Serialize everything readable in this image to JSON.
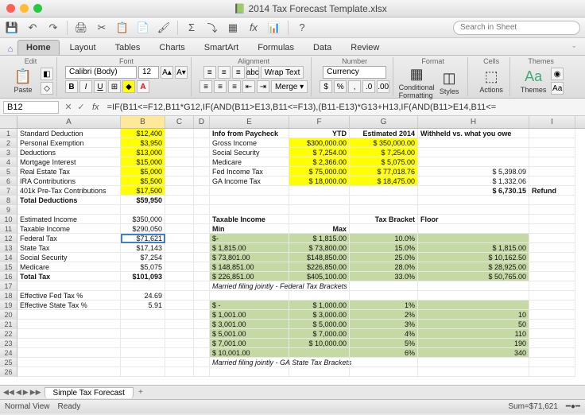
{
  "window": {
    "title": "2014 Tax Forecast Template.xlsx"
  },
  "search": {
    "placeholder": "Search in Sheet"
  },
  "tabs": [
    "Home",
    "Layout",
    "Tables",
    "Charts",
    "SmartArt",
    "Formulas",
    "Data",
    "Review"
  ],
  "ribbon": {
    "edit": "Edit",
    "font": "Font",
    "alignment": "Alignment",
    "number": "Number",
    "format": "Format",
    "cells": "Cells",
    "themes": "Themes",
    "paste": "Paste",
    "fontname": "Calibri (Body)",
    "fontsize": "12",
    "wrap": "Wrap Text",
    "numfmt": "Currency",
    "conditional": "Conditional Formatting",
    "styles": "Styles",
    "actions": "Actions",
    "themesbtn": "Themes"
  },
  "namebox": "B12",
  "formula": "=IF(B11<=F12,B11*G12,IF(AND(B11>E13,B11<=F13),(B11-E13)*G13+H13,IF(AND(B11>E14,B11<=",
  "cols": [
    "A",
    "B",
    "C",
    "D",
    "E",
    "F",
    "G",
    "H",
    "I"
  ],
  "grid": {
    "r1": {
      "A": "Standard Deduction",
      "B": "$12,400",
      "E": "Info from Paycheck",
      "F": "YTD",
      "G": "Estimated 2014",
      "H": "Withheld vs. what you owe"
    },
    "r2": {
      "A": "Personal Exemption",
      "B": "$3,950",
      "E": "Gross Income",
      "F": "$300,000.00",
      "G": "$   350,000.00"
    },
    "r3": {
      "A": "Deductions",
      "B": "$13,000",
      "E": "Social Security",
      "F": "$    7,254.00",
      "G": "$       7,254.00"
    },
    "r4": {
      "A": "Mortgage Interest",
      "B": "$15,000",
      "E": "Medicare",
      "F": "$    2,366.00",
      "G": "$       5,075.00"
    },
    "r5": {
      "A": "Real Estate Tax",
      "B": "$5,000",
      "E": "Fed Income Tax",
      "F": "$  75,000.00",
      "G": "$     77,018.76",
      "H": "$                         5,398.09"
    },
    "r6": {
      "A": "IRA Contributions",
      "B": "$5,500",
      "E": "GA Income Tax",
      "F": "$  18,000.00",
      "G": "$     18,475.00",
      "H": "$                         1,332.06"
    },
    "r7": {
      "A": "401k Pre-Tax Contributions",
      "B": "$17,500",
      "H": "$                         6,730.15",
      "I": "Refund"
    },
    "r8": {
      "A": "Total Deductions",
      "B": "$59,950"
    },
    "r10": {
      "A": "Estimated Income",
      "B": "$350,000",
      "E": "Taxable Income",
      "G": "Tax Bracket",
      "H": "Floor"
    },
    "r11": {
      "A": "Taxable Income",
      "B": "$290,050",
      "E": "Min",
      "F": "Max"
    },
    "r12": {
      "A": "Federal Tax",
      "B": "$71,621",
      "E": "$-",
      "F": "$    1,815.00",
      "G": "10.0%"
    },
    "r13": {
      "A": "State Tax",
      "B": "$17,143",
      "E": "$           1,815.00",
      "F": "$  73,800.00",
      "G": "15.0%",
      "H": "$                         1,815.00"
    },
    "r14": {
      "A": "Social Security",
      "B": "$7,254",
      "E": "$         73,801.00",
      "F": "$148,850.00",
      "G": "25.0%",
      "H": "$                       10,162.50"
    },
    "r15": {
      "A": "Medicare",
      "B": "$5,075",
      "E": "$       148,851.00",
      "F": "$226,850.00",
      "G": "28.0%",
      "H": "$                       28,925.00"
    },
    "r16": {
      "A": "Total Tax",
      "B": "$101,093",
      "E": "$       226,851.00",
      "F": "$405,100.00",
      "G": "33.0%",
      "H": "$                       50,765.00"
    },
    "r17": {
      "E": "Married filing jointly - Federal Tax Brackets"
    },
    "r18": {
      "A": "Effective Fed Tax %",
      "B": "24.69"
    },
    "r19": {
      "A": "Effective State Tax %",
      "B": "5.91",
      "E": "$                        -",
      "F": "$    1,000.00",
      "G": "1%"
    },
    "r20": {
      "E": "$           1,001.00",
      "F": "$    3,000.00",
      "G": "2%",
      "H": "10"
    },
    "r21": {
      "E": "$           3,001.00",
      "F": "$    5,000.00",
      "G": "3%",
      "H": "50"
    },
    "r22": {
      "E": "$           5,001.00",
      "F": "$    7,000.00",
      "G": "4%",
      "H": "110"
    },
    "r23": {
      "E": "$           7,001.00",
      "F": "$  10,000.00",
      "G": "5%",
      "H": "190"
    },
    "r24": {
      "E": "$         10,001.00",
      "F": "",
      "G": "6%",
      "H": "340"
    },
    "r25": {
      "E": "Married filing jointly - GA State Tax Brackets"
    }
  },
  "sheettab": "Simple Tax Forecast",
  "status": {
    "view": "Normal View",
    "state": "Ready",
    "sum": "Sum=$71,621"
  }
}
